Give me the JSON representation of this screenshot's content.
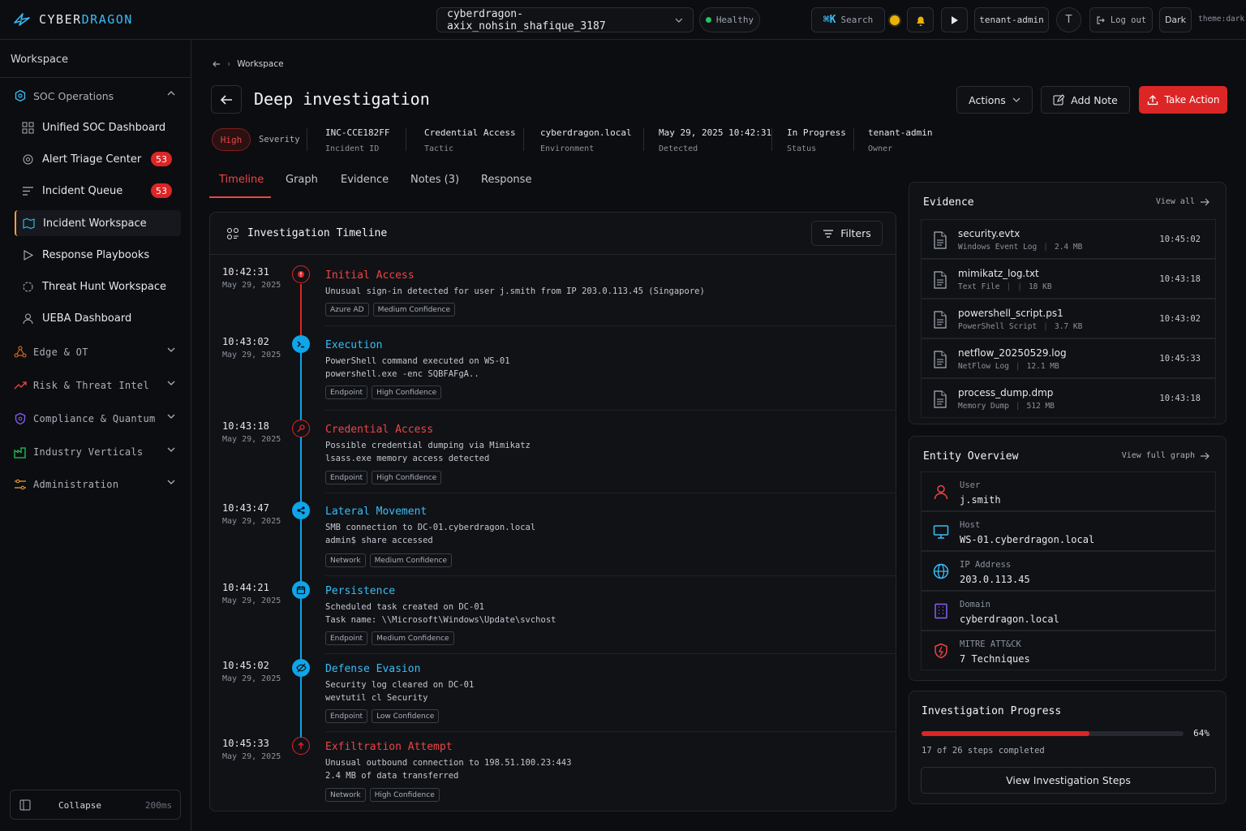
{
  "app": {
    "logo_prefix": "CYBER",
    "logo_accent": "DRAGON"
  },
  "topbar": {
    "tenant": "cyberdragon-axix_nohsin_shafique_3187",
    "health": "Healthy",
    "search_kbd": "⌘K",
    "search_label": "Search",
    "user_role": "tenant-admin",
    "avatar_initial": "T",
    "logout": "Log out",
    "theme_button": "Dark",
    "theme_label": "theme:dark"
  },
  "sidebar": {
    "workspace_label": "Workspace",
    "soc_group": "SOC Operations",
    "items": [
      {
        "label": "Unified SOC Dashboard"
      },
      {
        "label": "Alert Triage Center",
        "badge": "53"
      },
      {
        "label": "Incident Queue",
        "badge": "53"
      },
      {
        "label": "Incident Workspace"
      },
      {
        "label": "Response Playbooks"
      },
      {
        "label": "Threat Hunt Workspace"
      },
      {
        "label": "UEBA Dashboard"
      }
    ],
    "groups": [
      {
        "label": "Edge & OT"
      },
      {
        "label": "Risk & Threat Intel"
      },
      {
        "label": "Compliance & Quantum"
      },
      {
        "label": "Industry Verticals"
      },
      {
        "label": "Administration"
      }
    ],
    "collapse_label": "Collapse",
    "collapse_timing": "200ms"
  },
  "breadcrumb": {
    "item": "Workspace"
  },
  "page": {
    "title": "Deep investigation",
    "actions_label": "Actions",
    "add_note_label": "Add Note",
    "take_action_label": "Take Action"
  },
  "meta": {
    "severity": "High",
    "severity_label": "Severity",
    "items": [
      {
        "value": "INC-CCE182FF",
        "key": "Incident ID"
      },
      {
        "value": "Credential Access",
        "key": "Tactic"
      },
      {
        "value": "cyberdragon.local",
        "key": "Environment"
      },
      {
        "value": "May 29, 2025 10:42:31",
        "key": "Detected"
      },
      {
        "value": "In Progress",
        "key": "Status"
      },
      {
        "value": "tenant-admin",
        "key": "Owner"
      }
    ]
  },
  "tabs": [
    "Timeline",
    "Graph",
    "Evidence",
    "Notes (3)",
    "Response"
  ],
  "timeline": {
    "title": "Investigation Timeline",
    "filters_label": "Filters",
    "events": [
      {
        "time": "10:42:31",
        "date": "May 29, 2025",
        "title": "Initial Access",
        "color": "red",
        "icon": "alert-circle-icon",
        "line1": "Unusual sign-in detected for user j.smith from IP 203.0.113.45 (Singapore)",
        "line2": "",
        "tags": [
          "Azure AD",
          "Medium Confidence"
        ]
      },
      {
        "time": "10:43:02",
        "date": "May 29, 2025",
        "title": "Execution",
        "color": "blue",
        "icon": "terminal-icon",
        "line1": "PowerShell command executed on WS-01",
        "line2": "powershell.exe -enc SQBFAFgA..",
        "tags": [
          "Endpoint",
          "High Confidence"
        ]
      },
      {
        "time": "10:43:18",
        "date": "May 29, 2025",
        "title": "Credential Access",
        "color": "red",
        "icon": "key-icon",
        "line1": "Possible credential dumping via Mimikatz",
        "line2": "lsass.exe memory access detected",
        "tags": [
          "Endpoint",
          "High Confidence"
        ]
      },
      {
        "time": "10:43:47",
        "date": "May 29, 2025",
        "title": "Lateral Movement",
        "color": "blue",
        "icon": "network-icon",
        "line1": "SMB connection to DC-01.cyberdragon.local",
        "line2": "admin$ share accessed",
        "tags": [
          "Network",
          "Medium Confidence"
        ]
      },
      {
        "time": "10:44:21",
        "date": "May 29, 2025",
        "title": "Persistence",
        "color": "blue",
        "icon": "calendar-icon",
        "line1": "Scheduled task created on DC-01",
        "line2": "Task name: \\\\Microsoft\\Windows\\Update\\svchost",
        "tags": [
          "Endpoint",
          "Medium Confidence"
        ]
      },
      {
        "time": "10:45:02",
        "date": "May 29, 2025",
        "title": "Defense Evasion",
        "color": "blue",
        "icon": "eye-off-icon",
        "line1": "Security log cleared on DC-01",
        "line2": "wevtutil cl Security",
        "tags": [
          "Endpoint",
          "Low Confidence"
        ]
      },
      {
        "time": "10:45:33",
        "date": "May 29, 2025",
        "title": "Exfiltration Attempt",
        "color": "red",
        "icon": "upload-icon",
        "line1": "Unusual outbound connection to 198.51.100.23:443",
        "line2": "2.4 MB of data transferred",
        "tags": [
          "Network",
          "High Confidence"
        ]
      }
    ]
  },
  "evidence": {
    "title": "Evidence",
    "view_all": "View all",
    "files": [
      {
        "name": "security.evtx",
        "type": "Windows Event Log",
        "size": "2.4 MB",
        "time": "10:45:02"
      },
      {
        "name": "mimikatz_log.txt",
        "type": "Text File",
        "size": "18 KB",
        "time": "10:43:18"
      },
      {
        "name": "powershell_script.ps1",
        "type": "PowerShell Script",
        "size": "3.7 KB",
        "time": "10:43:02"
      },
      {
        "name": "netflow_20250529.log",
        "type": "NetFlow Log",
        "size": "12.1 MB",
        "time": "10:45:33"
      },
      {
        "name": "process_dump.dmp",
        "type": "Memory Dump",
        "size": "512 MB",
        "time": "10:43:18"
      }
    ]
  },
  "entities": {
    "title": "Entity Overview",
    "view_graph": "View full graph",
    "items": [
      {
        "key": "User",
        "value": "j.smith",
        "icon": "user-icon"
      },
      {
        "key": "Host",
        "value": "WS-01.cyberdragon.local",
        "icon": "monitor-icon"
      },
      {
        "key": "IP Address",
        "value": "203.0.113.45",
        "icon": "globe-icon"
      },
      {
        "key": "Domain",
        "value": "cyberdragon.local",
        "icon": "building-icon"
      },
      {
        "key": "MITRE ATT&CK",
        "value": "7 Techniques",
        "icon": "shield-icon"
      }
    ]
  },
  "progress": {
    "title": "Investigation Progress",
    "percent": 64,
    "percent_label": "64%",
    "steps": "17 of 26 steps completed",
    "button": "View Investigation Steps"
  },
  "colors": {
    "accent_red": "#dc2626",
    "accent_blue": "#0ea5e9",
    "active_marker": "#f0a33a",
    "healthy": "#22c55e"
  }
}
